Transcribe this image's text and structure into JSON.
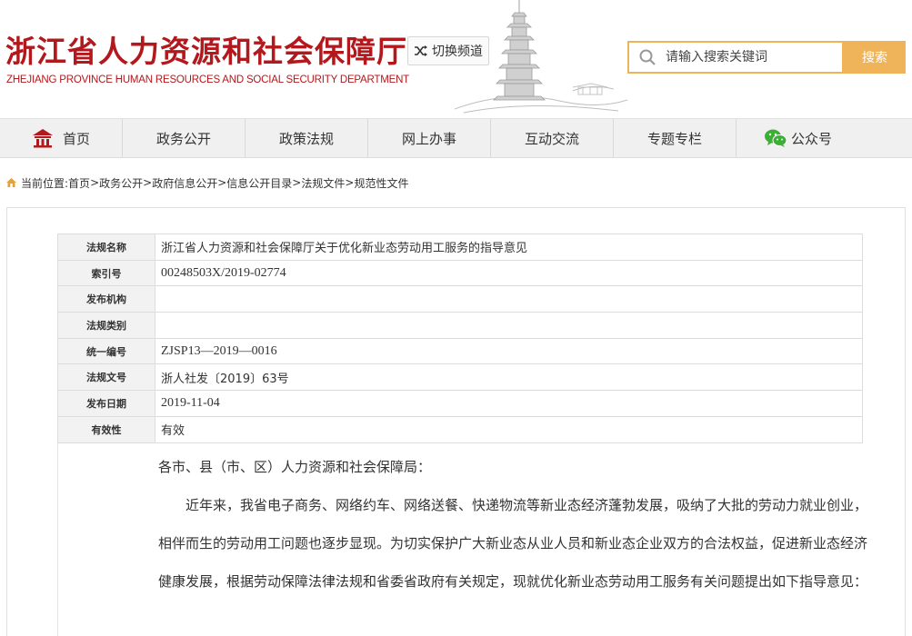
{
  "header": {
    "title_cn": "浙江省人力资源和社会保障厅",
    "title_en": "ZHEJIANG PROVINCE HUMAN RESOURCES AND SOCIAL SECURITY DEPARTMENT",
    "switch_label": "切换频道",
    "search": {
      "placeholder": "请输入搜索关键词",
      "button_label": "搜索"
    }
  },
  "nav": {
    "items": [
      {
        "label": "首页",
        "icon": "home-icon"
      },
      {
        "label": "政务公开"
      },
      {
        "label": "政策法规"
      },
      {
        "label": "网上办事"
      },
      {
        "label": "互动交流"
      },
      {
        "label": "专题专栏"
      },
      {
        "label": "公众号",
        "icon": "wechat-icon"
      }
    ]
  },
  "breadcrumb": {
    "prefix": "当前位置:",
    "items": [
      "首页",
      "政务公开",
      "政府信息公开",
      "信息公开目录",
      "法规文件",
      "规范性文件"
    ],
    "separator": ">"
  },
  "meta": {
    "rows": [
      {
        "key": "法规名称",
        "value": "浙江省人力资源和社会保障厅关于优化新业态劳动用工服务的指导意见"
      },
      {
        "key": "索引号",
        "value": "00248503X/2019-02774"
      },
      {
        "key": "发布机构",
        "value": ""
      },
      {
        "key": "法规类别",
        "value": ""
      },
      {
        "key": "统一编号",
        "value": "ZJSP13—2019—0016"
      },
      {
        "key": "法规文号",
        "value": "浙人社发〔2019〕63号"
      },
      {
        "key": "发布日期",
        "value": "2019-11-04"
      },
      {
        "key": "有效性",
        "value": "有效"
      }
    ]
  },
  "body": {
    "salutation": "各市、县（市、区）人力资源和社会保障局：",
    "paragraph": "近年来，我省电子商务、网络约车、网络送餐、快递物流等新业态经济蓬勃发展，吸纳了大批的劳动力就业创业，相伴而生的劳动用工问题也逐步显现。为切实保护广大新业态从业人员和新业态企业双方的合法权益，促进新业态经济健康发展，根据劳动保障法律法规和省委省政府有关规定，现就优化新业态劳动用工服务有关问题提出如下指导意见："
  },
  "colors": {
    "brand_red": "#b3181c",
    "accent_orange": "#efb45a"
  }
}
